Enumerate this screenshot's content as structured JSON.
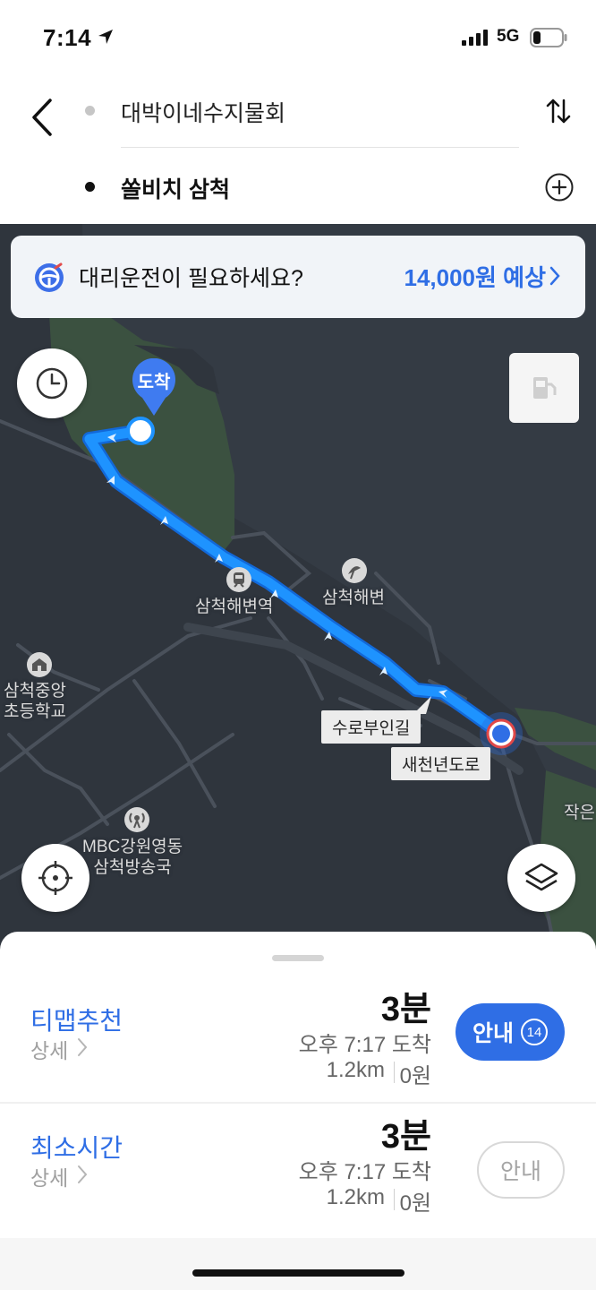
{
  "status_bar": {
    "time": "7:14",
    "network": "5G"
  },
  "header": {
    "origin": "대박이네수지물회",
    "destination": "쏠비치 삼척"
  },
  "banner": {
    "text": "대리운전이 필요하세요?",
    "price": "14,000원 예상"
  },
  "map": {
    "arrival_pin": "도착",
    "labels": {
      "station": "삼척해변역",
      "beach": "삼척해변",
      "school_line1": "삼척중앙",
      "school_line2": "초등학교",
      "broadcast_line1": "MBC강원영동",
      "broadcast_line2": "삼척방송국",
      "edge": "작은"
    },
    "road_tags": [
      "수로부인길",
      "새천년도로"
    ],
    "colors": {
      "route": "#1a8cff",
      "land": "#3b5140",
      "water": "#343b44"
    }
  },
  "routes": [
    {
      "name": "티맵추천",
      "detail": "상세",
      "duration": "3분",
      "arrival": "오후 7:17 도착",
      "distance": "1.2km",
      "cost": "0원",
      "button": "안내",
      "badge": "14"
    },
    {
      "name": "최소시간",
      "detail": "상세",
      "duration": "3분",
      "arrival": "오후 7:17 도착",
      "distance": "1.2km",
      "cost": "0원",
      "button": "안내"
    }
  ],
  "icons": [
    "location-arrow-icon",
    "signal-icon",
    "battery-icon",
    "back-icon",
    "swap-icon",
    "add-waypoint-icon",
    "steering-wheel-icon",
    "chevron-right-icon",
    "clock-icon",
    "fuel-icon",
    "locate-icon",
    "layers-icon",
    "train-icon",
    "beach-icon",
    "school-icon",
    "broadcast-icon"
  ]
}
